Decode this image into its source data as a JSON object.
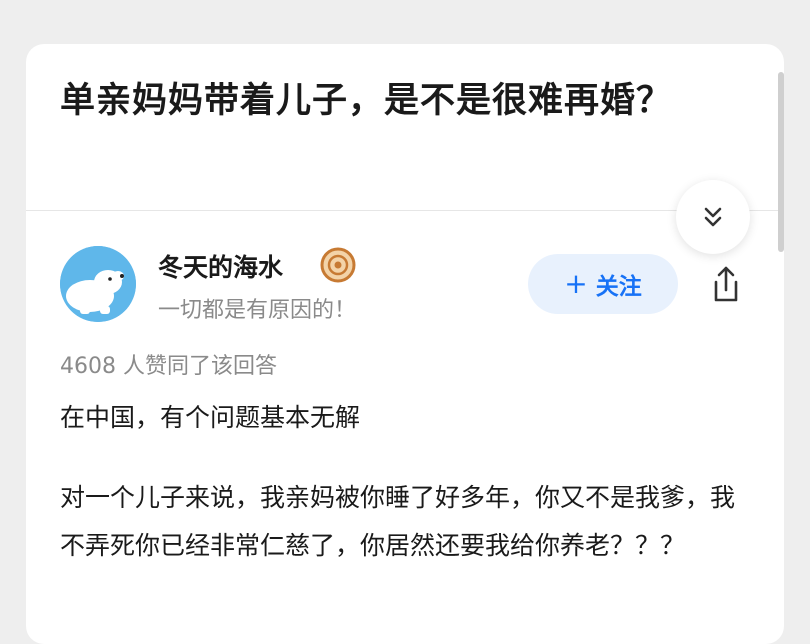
{
  "question": {
    "title": "单亲妈妈带着儿子，是不是很难再婚？"
  },
  "answer": {
    "author": {
      "name": "冬天的海水",
      "bio": "一切都是有原因的！",
      "badge_icon": "badge-icon",
      "avatar_color": "#5fb7ea"
    },
    "follow": {
      "plus": "+",
      "label": "关注"
    },
    "votes": "4608 人赞同了该回答",
    "paragraphs": [
      "在中国，有个问题基本无解",
      "对一个儿子来说，我亲妈被你睡了好多年，你又不是我爹，我不弄死你已经非常仁慈了，你居然还要我给你养老？？？"
    ]
  },
  "colors": {
    "accent": "#1772f6",
    "follow_bg": "#e8f1fd",
    "text": "#1a1a1a",
    "muted": "#8a8a8a"
  }
}
